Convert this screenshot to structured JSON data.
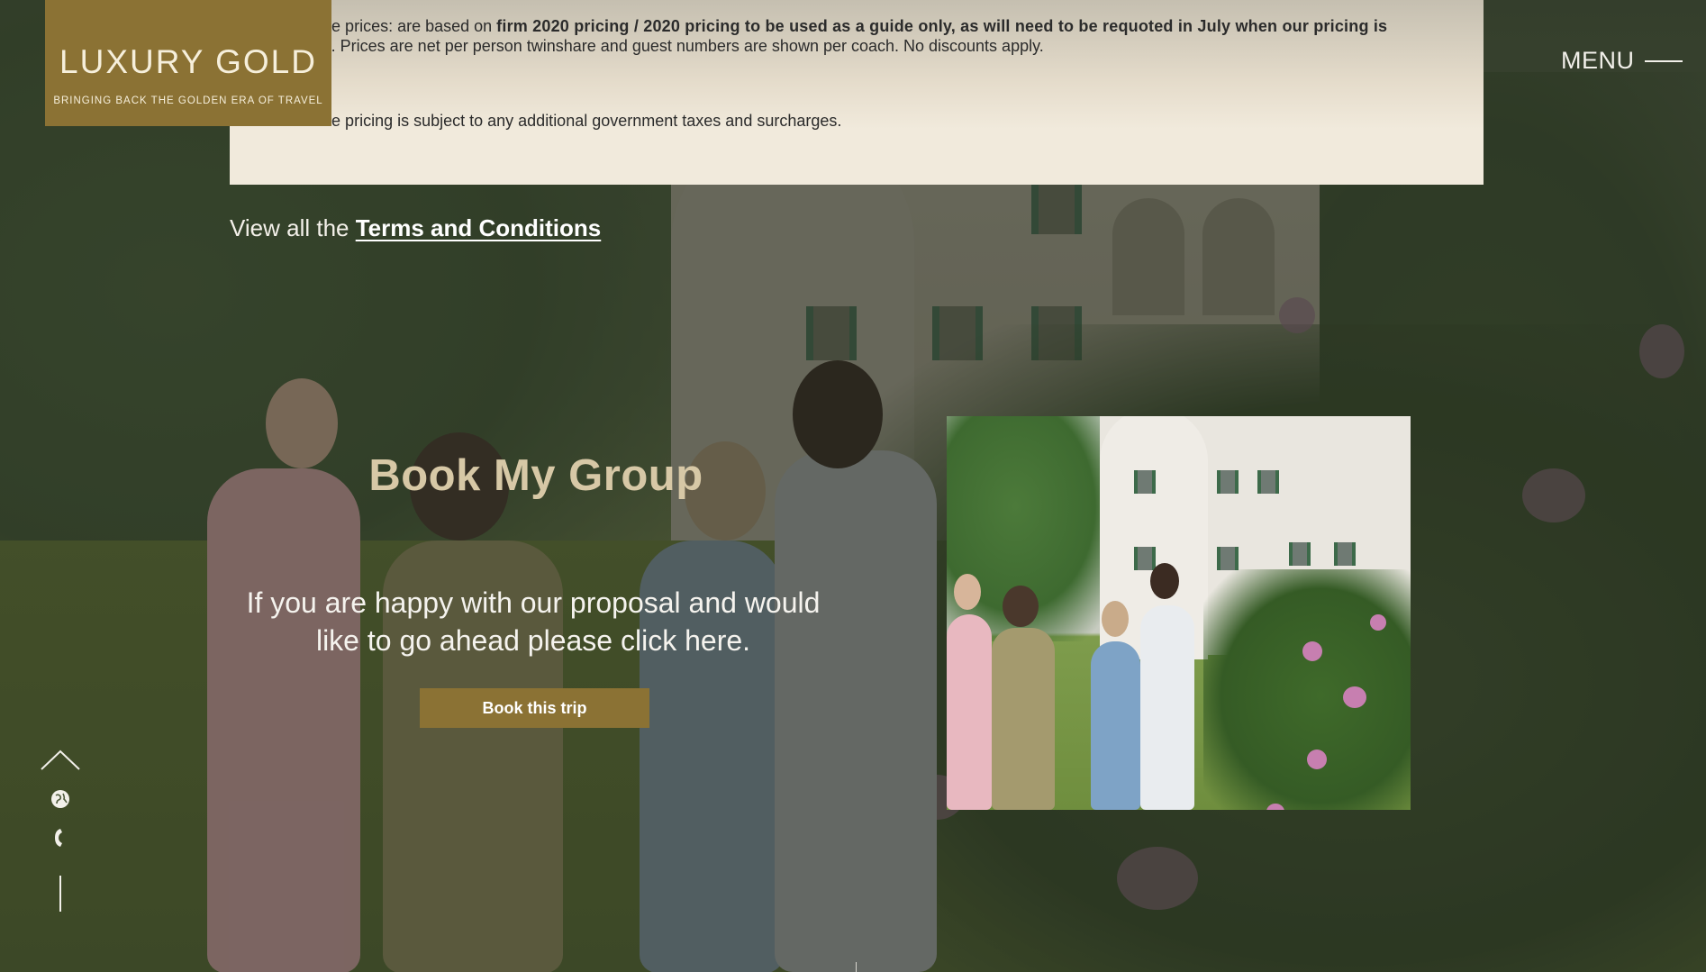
{
  "brand": {
    "name": "LUXURY GOLD",
    "tagline": "BRINGING BACK THE GOLDEN ERA OF TRAVEL",
    "color": "#8b7234"
  },
  "nav": {
    "menu_label": "MENU"
  },
  "pricing_notes": {
    "line1_prefix": "The above prices: are based on ",
    "line1_bold": "firm 2020 pricing / 2020 pricing to be used as a guide only, as will need to be requoted in July when our pricing is released",
    "line1_suffix": ". Prices are net per person twinshare and guest numbers are shown per coach. No discounts apply.",
    "line2": "The above pricing is subject to any additional government taxes and surcharges."
  },
  "terms": {
    "prefix": "View all the ",
    "link_label": "Terms and Conditions"
  },
  "booking": {
    "title": "Book My Group",
    "text": "If you are happy with our proposal and would like to go ahead please click here.",
    "button_label": "Book this trip"
  },
  "side_controls": {
    "icons": [
      "chevron-up-icon",
      "globe-icon",
      "phone-icon"
    ]
  },
  "colors": {
    "accent": "#8b7234",
    "title_gold": "#d7c8a6",
    "panel": "#f1eadc"
  }
}
